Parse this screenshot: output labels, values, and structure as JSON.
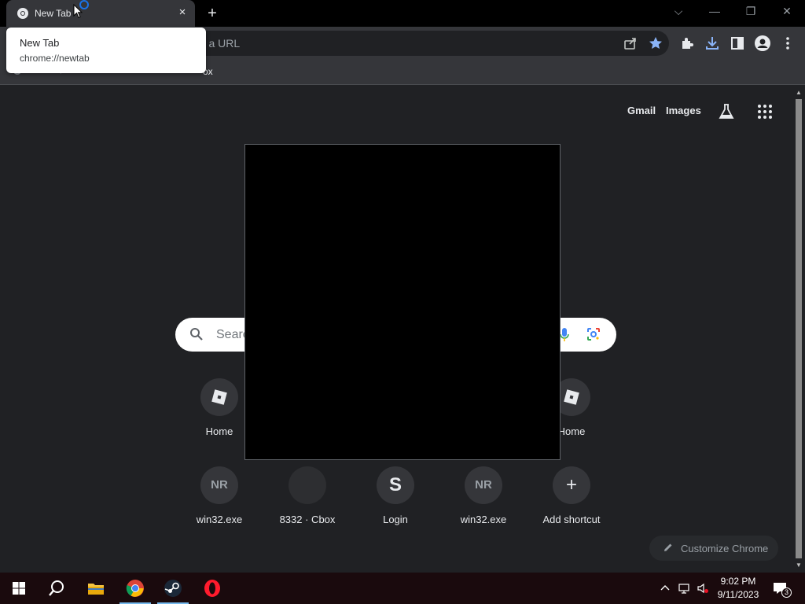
{
  "browser": {
    "tab": {
      "title": "New Tab",
      "close_glyph": "×"
    },
    "new_tab_glyph": "+",
    "window_controls": {
      "dropdown": "⌵",
      "minimize": "—",
      "restore": "❐",
      "close": "✕"
    },
    "omnibox": {
      "placeholder": "pe a URL"
    },
    "bookmarks": {
      "visible_fragment": "ox"
    },
    "tooltip": {
      "title": "New Tab",
      "url": "chrome://newtab"
    }
  },
  "newtab": {
    "top_links": {
      "gmail": "Gmail",
      "images": "Images"
    },
    "search": {
      "placeholder": "Searc"
    },
    "shortcuts": [
      {
        "label": "Home",
        "icon": "roblox-icon",
        "letter": ""
      },
      {
        "label": "Home",
        "icon": "roblox-icon",
        "letter": ""
      },
      {
        "label": "win32.exe",
        "icon": "",
        "letter": "NR"
      },
      {
        "label": "8332 · Cbox",
        "icon": "",
        "letter": ""
      },
      {
        "label": "Login",
        "icon": "",
        "letter": "S"
      },
      {
        "label": "win32.exe",
        "icon": "",
        "letter": "NR"
      },
      {
        "label": "Add shortcut",
        "icon": "plus-icon",
        "letter": "+"
      }
    ],
    "customize_label": "Customize Chrome"
  },
  "taskbar": {
    "time": "9:02 PM",
    "date": "9/11/2023",
    "notification_count": "3"
  },
  "colors": {
    "accent_blue": "#8ab4f8",
    "background": "#202124",
    "toolbar": "#35363a"
  }
}
